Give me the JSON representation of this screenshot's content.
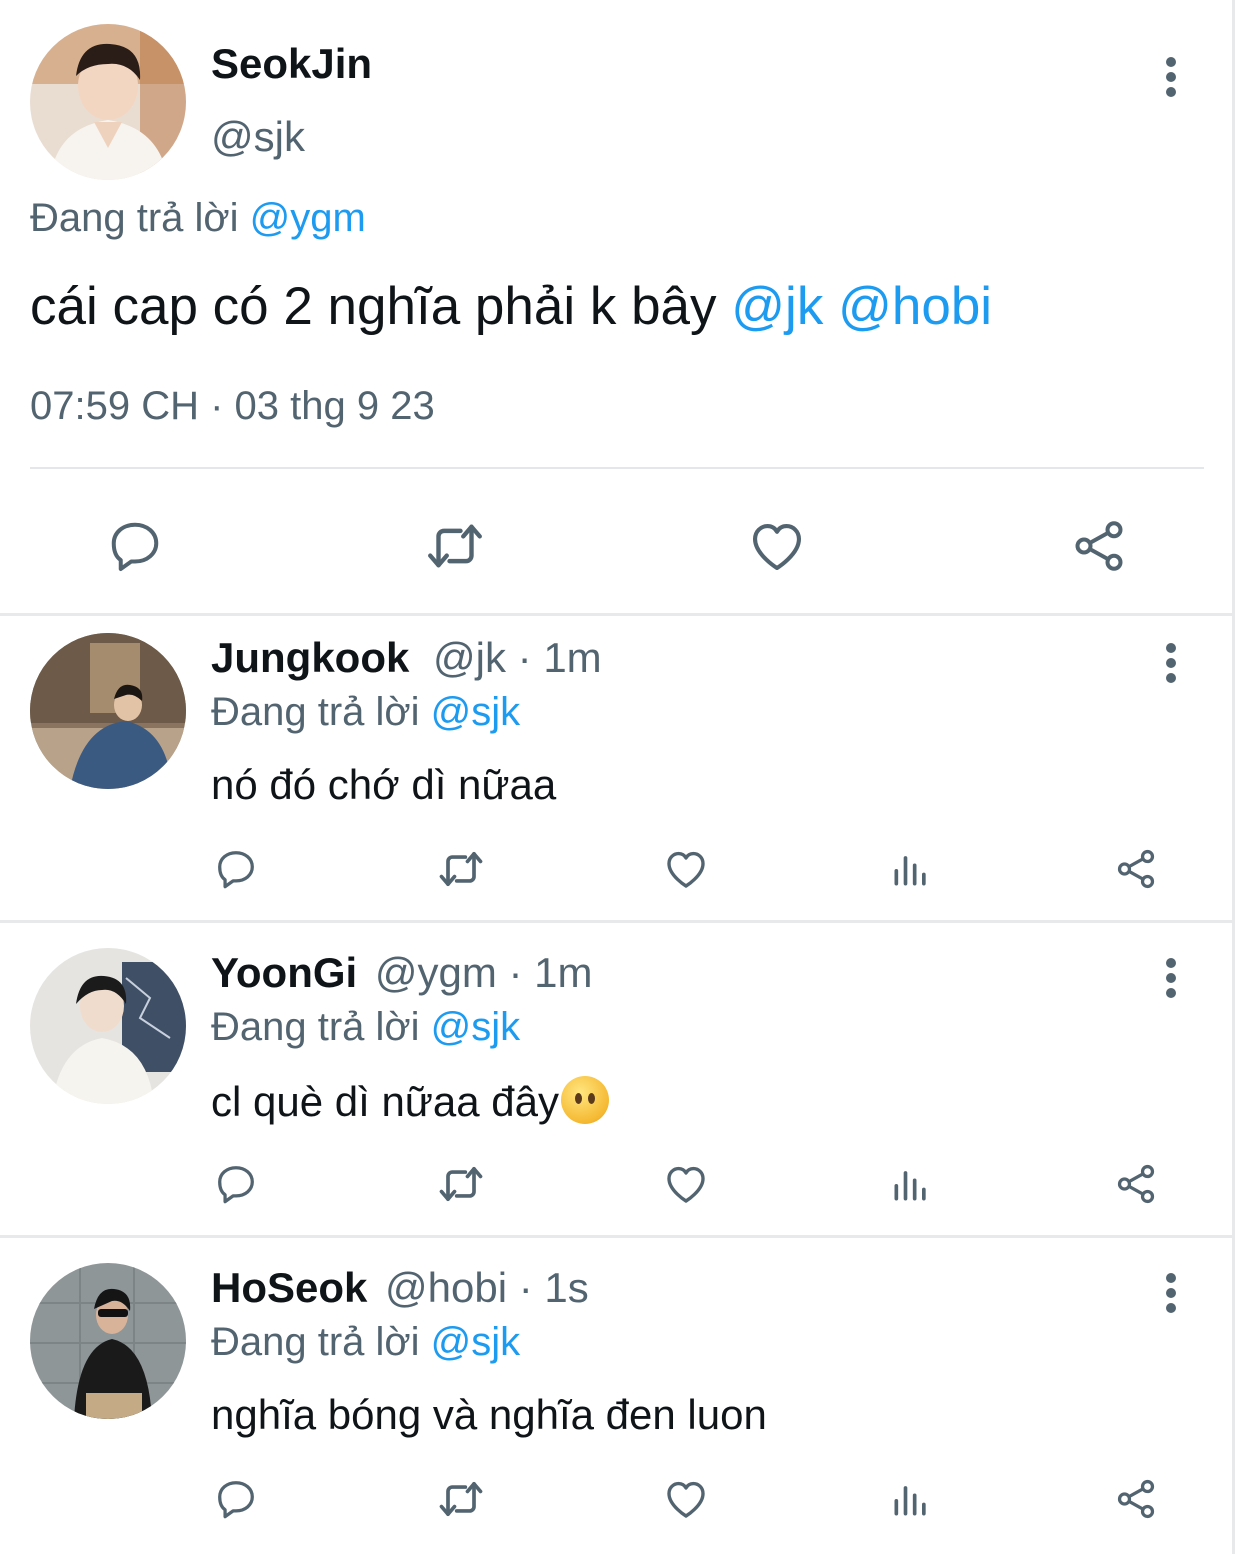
{
  "main_tweet": {
    "name": "SeokJin",
    "handle": "@sjk",
    "reply_prefix": "Đang trả lời",
    "reply_to": "@ygm",
    "text": "cái cap có 2 nghĩa phải k bây",
    "mention_1": "@jk",
    "mention_2": "@hobi",
    "timestamp": "07:59 CH · 03 thg 9 23",
    "actions": [
      "reply-icon",
      "retweet-icon",
      "like-icon",
      "share-icon"
    ]
  },
  "replies": [
    {
      "name": "Jungkook",
      "meta": "@jk · 1m",
      "reply_prefix": "Đang trả lời",
      "reply_to": "@sjk",
      "text": "nó đó chớ dì nữaa"
    },
    {
      "name": "YoonGi",
      "meta": "@ygm · 1m",
      "reply_prefix": "Đang trả lời",
      "reply_to": "@sjk",
      "text": "cl què dì nữaa đây",
      "emoji": "face-without-mouth-emoji"
    },
    {
      "name": "HoSeok",
      "meta": "@hobi · 1s",
      "reply_prefix": "Đang trả lời",
      "reply_to": "@sjk",
      "text": "nghĩa bóng và nghĩa đen luon"
    }
  ],
  "colors": {
    "text": "#0f1419",
    "secondary": "#536471",
    "link": "#1d9bf0",
    "divider": "#e7e9eb"
  }
}
